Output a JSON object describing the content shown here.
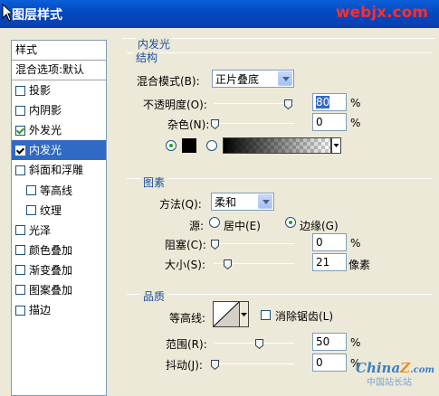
{
  "window": {
    "title": "图层样式"
  },
  "watermark": {
    "site": "webjx.com",
    "logo_text": "China",
    "logo_z": "Z",
    "logo_suffix": ".com",
    "logo_sub": "中国站长站"
  },
  "sidebar": {
    "header": "样式",
    "blend_options": "混合选项:默认",
    "items": [
      {
        "label": "投影",
        "checked": false
      },
      {
        "label": "内阴影",
        "checked": false
      },
      {
        "label": "外发光",
        "checked": true
      },
      {
        "label": "内发光",
        "checked": true,
        "selected": true
      },
      {
        "label": "斜面和浮雕",
        "checked": false
      },
      {
        "label": "等高线",
        "checked": false,
        "sub": true
      },
      {
        "label": "纹理",
        "checked": false,
        "sub": true
      },
      {
        "label": "光泽",
        "checked": false
      },
      {
        "label": "颜色叠加",
        "checked": false
      },
      {
        "label": "渐变叠加",
        "checked": false
      },
      {
        "label": "图案叠加",
        "checked": false
      },
      {
        "label": "描边",
        "checked": false
      }
    ]
  },
  "inner_glow": {
    "title": "内发光",
    "structure": {
      "title": "结构",
      "blend_mode_label": "混合模式(B):",
      "blend_mode_value": "正片叠底",
      "opacity_label": "不透明度(O):",
      "opacity_value": "80",
      "opacity_unit": "%",
      "noise_label": "杂色(N):",
      "noise_value": "0",
      "noise_unit": "%",
      "color_swatch": "#000000"
    },
    "elements": {
      "title": "图素",
      "method_label": "方法(Q):",
      "method_value": "柔和",
      "source_label": "源:",
      "source_center": "居中(E)",
      "source_edge": "边缘(G)",
      "source_selected": "edge",
      "choke_label": "阻塞(C):",
      "choke_value": "0",
      "choke_unit": "%",
      "size_label": "大小(S):",
      "size_value": "21",
      "size_unit": "像素"
    },
    "quality": {
      "title": "品质",
      "contour_label": "等高线:",
      "antialias_label": "消除锯齿(L)",
      "antialias_checked": false,
      "range_label": "范围(R):",
      "range_value": "50",
      "range_unit": "%",
      "jitter_label": "抖动(J):",
      "jitter_value": "0",
      "jitter_unit": "%"
    }
  }
}
